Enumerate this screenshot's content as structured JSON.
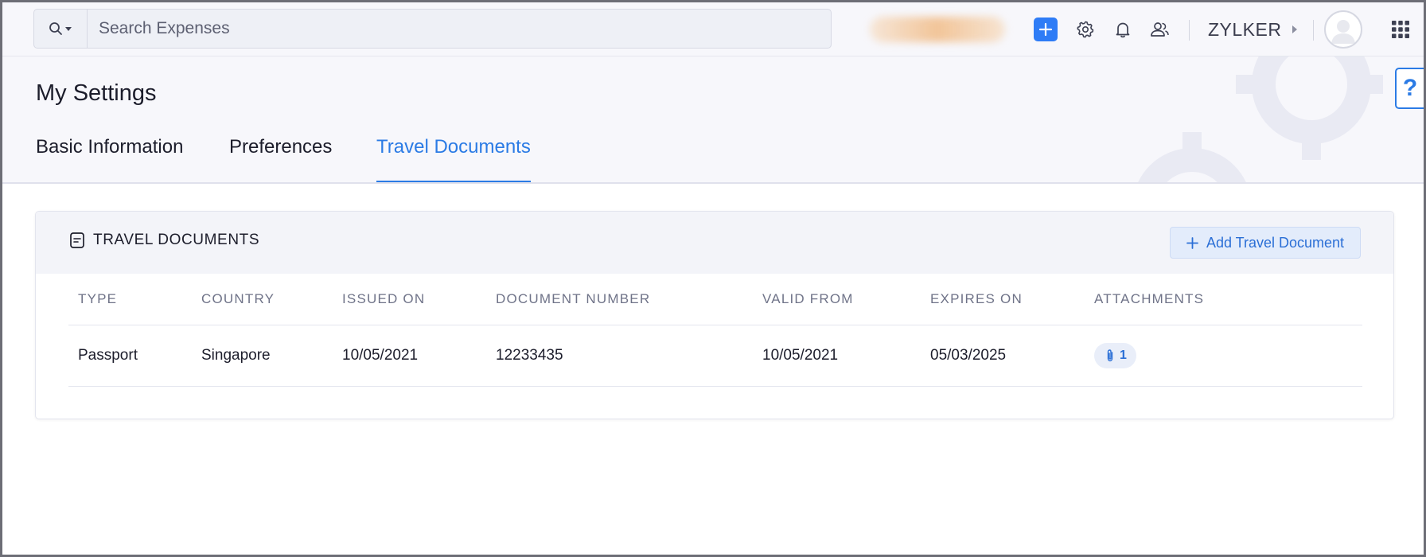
{
  "search": {
    "placeholder": "Search Expenses",
    "value": ""
  },
  "topbar": {
    "org_name": "ZYLKER",
    "icons": [
      "search-icon",
      "plus-icon",
      "gear-icon",
      "bell-icon",
      "users-icon",
      "caret-right-icon",
      "avatar",
      "apps-grid-icon"
    ],
    "accent": "#2e7cf6"
  },
  "header": {
    "title": "My Settings",
    "tabs": [
      {
        "label": "Basic Information",
        "active": false
      },
      {
        "label": "Preferences",
        "active": false
      },
      {
        "label": "Travel Documents",
        "active": true
      }
    ],
    "help_label": "?"
  },
  "card": {
    "title": "TRAVEL DOCUMENTS",
    "add_button_label": "Add Travel Document",
    "columns": [
      "TYPE",
      "COUNTRY",
      "ISSUED ON",
      "DOCUMENT NUMBER",
      "VALID FROM",
      "EXPIRES ON",
      "ATTACHMENTS"
    ],
    "rows": [
      {
        "type": "Passport",
        "country": "Singapore",
        "issued_on": "10/05/2021",
        "document_number": "12233435",
        "valid_from": "10/05/2021",
        "expires_on": "05/03/2025",
        "attachments": "1"
      }
    ]
  },
  "colors": {
    "active_tab": "#2b7be5",
    "header_bg": "#f7f7fb",
    "add_button_bg": "#e3ecfb"
  }
}
